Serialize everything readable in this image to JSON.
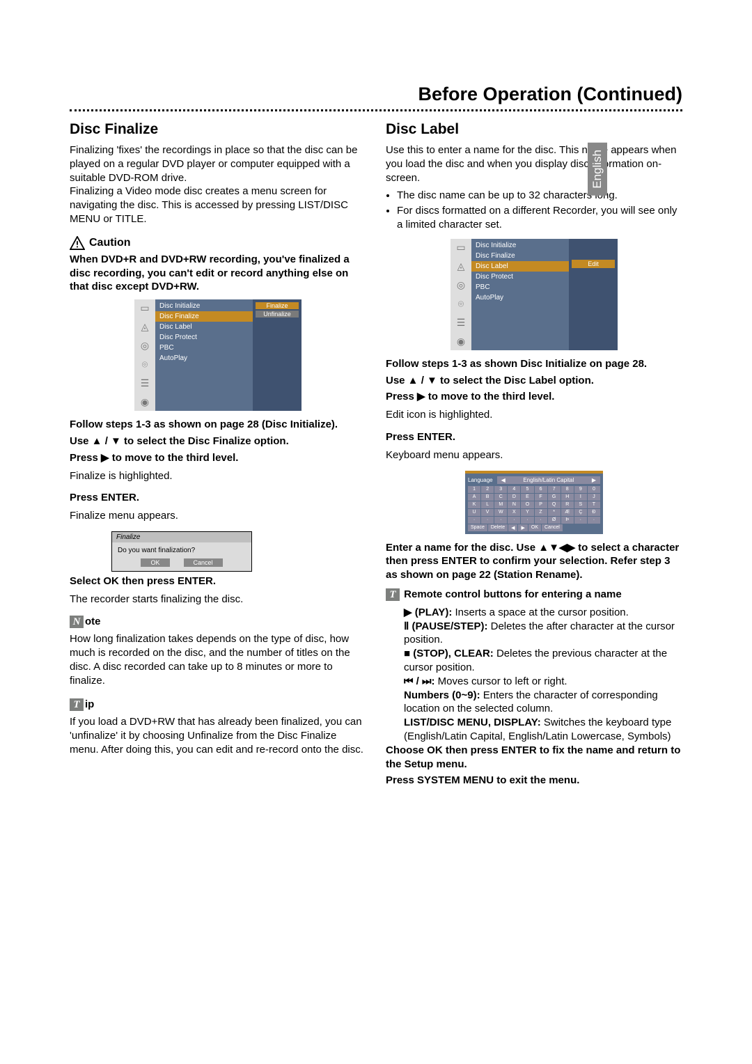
{
  "language_tab": "English",
  "header": "Before Operation (Continued)",
  "left": {
    "title": "Disc Finalize",
    "intro": "Finalizing 'fixes' the recordings in place so that the disc can be played on a regular DVD player or computer equipped with a suitable DVD-ROM drive.\nFinalizing a Video mode disc creates a menu screen for navigating the disc. This is accessed by pressing LIST/DISC MENU or TITLE.",
    "caution_label": "Caution",
    "caution_body": "When DVD+R and DVD+RW recording, you've finalized a disc recording, you can't edit or record anything else on that disc except DVD+RW.",
    "osd": {
      "items": [
        "Disc Initialize",
        "Disc Finalize",
        "Disc Label",
        "Disc Protect",
        "PBC",
        "AutoPlay"
      ],
      "selected": "Disc Finalize",
      "right": [
        "Finalize",
        "Unfinalize"
      ]
    },
    "step1_b": "Follow steps 1-3 as shown on page 28 (Disc Initialize).",
    "step2_b": "Use ▲ / ▼ to select the Disc Finalize option.",
    "step3_b": "Press ▶ to move to the third level.",
    "step3_t": "Finalize is highlighted.",
    "step4_b": "Press ENTER.",
    "step4_t": "Finalize menu appears.",
    "dialog_title": "Finalize",
    "dialog_msg": "Do you want finalization?",
    "dialog_ok": "OK",
    "dialog_cancel": "Cancel",
    "step5_b": "Select OK then press ENTER.",
    "step5_t": "The recorder starts finalizing the disc.",
    "note_label": "ote",
    "note_body": "How long finalization takes depends on the type of disc, how much is recorded on the disc, and the number of titles on the disc. A disc recorded can take up to 8 minutes or more to finalize.",
    "tip_label": "ip",
    "tip_body": "If you load a DVD+RW that has already been finalized, you can 'unfinalize' it by choosing Unfinalize from the Disc Finalize menu. After doing this, you can edit and re-record onto the disc."
  },
  "right": {
    "title": "Disc Label",
    "intro": "Use this to enter a name for the disc. This name appears when you load the disc and when you display disc information on-screen.",
    "bullets": [
      "The disc name can be up to 32 characters long.",
      "For discs formatted on a different Recorder, you will see only a limited character set."
    ],
    "osd": {
      "items": [
        "Disc Initialize",
        "Disc Finalize",
        "Disc Label",
        "Disc Protect",
        "PBC",
        "AutoPlay"
      ],
      "selected": "Disc Label",
      "right_btn": "Edit"
    },
    "step1_b": "Follow steps 1-3 as shown Disc Initialize on page 28.",
    "step2_b": "Use ▲ / ▼ to select the Disc Label option.",
    "step3_b": "Press ▶ to move to the third level.",
    "step3_t": "Edit icon is highlighted.",
    "step4_b": "Press ENTER.",
    "step4_t": "Keyboard menu appears.",
    "kbd": {
      "lang_label": "Language",
      "lang_value": "English/Latin Capital",
      "row1": [
        "1",
        "2",
        "3",
        "4",
        "5",
        "6",
        "7",
        "8",
        "9",
        "0"
      ],
      "row2": [
        "A",
        "B",
        "C",
        "D",
        "E",
        "F",
        "G",
        "H",
        "I",
        "J"
      ],
      "row3": [
        "K",
        "L",
        "M",
        "N",
        "O",
        "P",
        "Q",
        "R",
        "S",
        "T"
      ],
      "row4": [
        "U",
        "V",
        "W",
        "X",
        "Y",
        "Z",
        "*",
        "Æ",
        "Ç",
        "Ð"
      ],
      "row5": [
        "·",
        "·",
        "·",
        "·",
        "·",
        "·",
        "Ø",
        "Þ",
        "·",
        "·"
      ],
      "bottom": [
        "Space",
        "Delete",
        "◀",
        "▶",
        "OK",
        "Cancel"
      ]
    },
    "step5_b": "Enter a name for the disc. Use ▲▼◀▶ to select a character then press ENTER to confirm your selection. Refer step 3 as shown on page 22 (Station Rename).",
    "tip_label": "Remote control buttons for entering a name",
    "rc": [
      {
        "b": "▶ (PLAY):",
        "t": " Inserts a space at the cursor position."
      },
      {
        "b": "Ⅱ (PAUSE/STEP):",
        "t": " Deletes the after character at the cursor position."
      },
      {
        "b": "■ (STOP), CLEAR:",
        "t": " Deletes the previous character at the cursor position."
      },
      {
        "b": "⏮ / ⏭:",
        "t": " Moves cursor to left or right."
      },
      {
        "b": "Numbers (0~9):",
        "t": " Enters the character of corresponding location on the selected column."
      },
      {
        "b": "LIST/DISC MENU, DISPLAY:",
        "t": " Switches the keyboard type (English/Latin Capital, English/Latin Lowercase, Symbols)"
      }
    ],
    "step6_b": "Choose OK then press ENTER to fix the name and return to the Setup menu.",
    "step7_b": "Press SYSTEM MENU to exit the menu."
  }
}
